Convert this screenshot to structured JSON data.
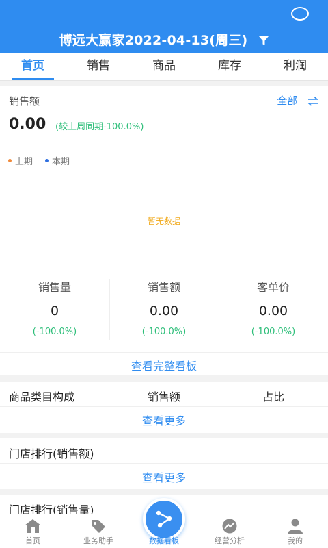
{
  "header": {
    "title": "博远大赢家2022-04-13(周三)"
  },
  "tabs": [
    {
      "label": "首页",
      "active": true
    },
    {
      "label": "销售",
      "active": false
    },
    {
      "label": "商品",
      "active": false
    },
    {
      "label": "库存",
      "active": false
    },
    {
      "label": "利润",
      "active": false
    }
  ],
  "summary": {
    "label": "销售额",
    "scope": "全部",
    "value": "0.00",
    "compare": "(较上周同期-100.0%)"
  },
  "legend": [
    {
      "label": "上期",
      "color": "#f08a3c"
    },
    {
      "label": "本期",
      "color": "#2f6fe0"
    }
  ],
  "chart": {
    "empty_text": "暂无数据"
  },
  "stats": [
    {
      "label": "销售量",
      "value": "0",
      "change": "(-100.0%)"
    },
    {
      "label": "销售额",
      "value": "0.00",
      "change": "(-100.0%)"
    },
    {
      "label": "客单价",
      "value": "0.00",
      "change": "(-100.0%)"
    }
  ],
  "full_board_link": "查看完整看板",
  "category_table": {
    "headers": [
      "商品类目构成",
      "销售额",
      "占比"
    ],
    "more": "查看更多"
  },
  "store_rank_amount": {
    "title": "门店排行(销售额)",
    "more": "查看更多"
  },
  "store_rank_qty": {
    "title": "门店排行(销售量)"
  },
  "bottom_nav": [
    {
      "label": "首页",
      "icon": "home-icon"
    },
    {
      "label": "业务助手",
      "icon": "tag-icon"
    },
    {
      "label": "数据看板",
      "icon": "dashboard-icon",
      "active": true
    },
    {
      "label": "经营分析",
      "icon": "trend-icon"
    },
    {
      "label": "我的",
      "icon": "user-icon"
    }
  ],
  "colors": {
    "primary": "#2f8cf0",
    "positive": "#2dbe79",
    "empty": "#f0a818"
  }
}
